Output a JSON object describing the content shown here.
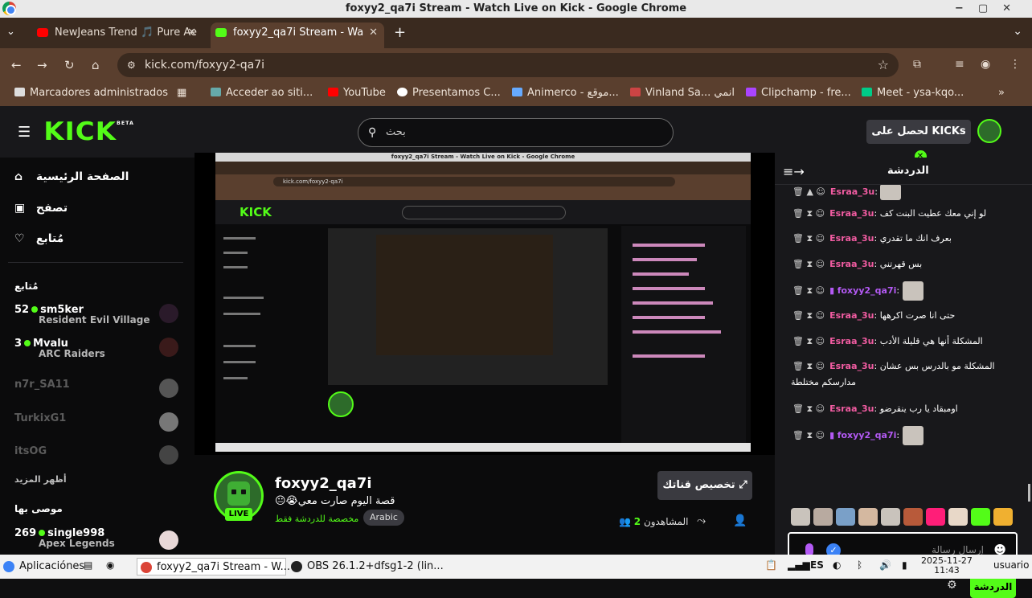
{
  "window": {
    "title": "foxyy2_qa7i Stream - Watch Live on Kick - Google Chrome"
  },
  "tabs": [
    {
      "label": "NewJeans Trend 🎵 Pure Ae",
      "favicon_color": "#ff0000"
    },
    {
      "label": "foxyy2_qa7i Stream - Wa",
      "favicon_color": "#53fc18"
    }
  ],
  "address": {
    "url": "kick.com/foxyy2-qa7i"
  },
  "bookmarks": [
    "Marcadores administrados",
    "Acceder ao siti...",
    "YouTube",
    "Presentamos C...",
    "Animerco - موقع...",
    "Vinland Sa... انمي",
    "Clipchamp - fre...",
    "Meet - ysa-kqo..."
  ],
  "header": {
    "search_placeholder": "بحث",
    "get_kicks": "لحصل على KICKs"
  },
  "sidebar": {
    "nav": [
      "الصفحة الرئيسية",
      "تصفح",
      "مُتابع"
    ],
    "following_title": "مُتابع",
    "following": [
      {
        "count": "52",
        "name": "sm5ker",
        "game": "Resident Evil Village",
        "live": true
      },
      {
        "count": "3",
        "name": "Mvalu",
        "game": "ARC Raiders",
        "live": true
      },
      {
        "count": "",
        "name": "n7r_SA11",
        "game": "",
        "live": false
      },
      {
        "count": "",
        "name": "TurkixG1",
        "game": "",
        "live": false
      },
      {
        "count": "",
        "name": "itsOG",
        "game": "",
        "live": false
      }
    ],
    "show_more": "أظهر المزيد",
    "recommended_title": "موصى بها",
    "recommended": [
      {
        "count": "269",
        "name": "single998",
        "game": "Apex Legends",
        "live": true
      }
    ]
  },
  "channel": {
    "name": "foxyy2_qa7i",
    "title": "😐😭قصة اليوم صارت معي",
    "subtitle": "مخصصة للدردشة فقط",
    "tag": "Arabic",
    "live_badge": "LIVE",
    "customize": "تخصيص قناتك",
    "viewers_label": "المشاهدون",
    "viewers": "2"
  },
  "chat": {
    "title": "الدردشة",
    "messages": [
      {
        "user": "Esraa_3u",
        "text": "",
        "has_image": true
      },
      {
        "user": "Esraa_3u",
        "text": "لو إني معك عطيت البنت كف"
      },
      {
        "user": "Esraa_3u",
        "text": "بعرف انك ما تقدري"
      },
      {
        "user": "Esraa_3u",
        "text": "بس قهرتني"
      },
      {
        "user": "foxyy2_qa7i",
        "text": "",
        "has_image": true,
        "owner": true
      },
      {
        "user": "Esraa_3u",
        "text": "حتى انا صرت اكرهها"
      },
      {
        "user": "Esraa_3u",
        "text": "المشكلة أنها هي قليلة الأدب"
      },
      {
        "user": "Esraa_3u",
        "text": "المشكلة مو بالدرس بس عشان",
        "cont": "مدارسكم مختلطة"
      },
      {
        "user": "Esraa_3u",
        "text": "اومبقاد يا رب ينقرضو"
      },
      {
        "user": "foxyy2_qa7i",
        "text": "",
        "has_image": true,
        "owner": true
      }
    ],
    "input_placeholder": "إرسال رسالة",
    "send": "الدردشة"
  },
  "taskbar": {
    "apps_label": "Aplicaciónes",
    "windows": [
      "foxyy2_qa7i Stream - W...",
      "OBS 26.1.2+dfsg1-2 (lin..."
    ],
    "lang": "ES",
    "date": "2025-11-27",
    "time": "11:43",
    "user": "usuario"
  },
  "colors": {
    "accent": "#53fc18",
    "username": "#f25ca2",
    "owner": "#b45af5"
  }
}
